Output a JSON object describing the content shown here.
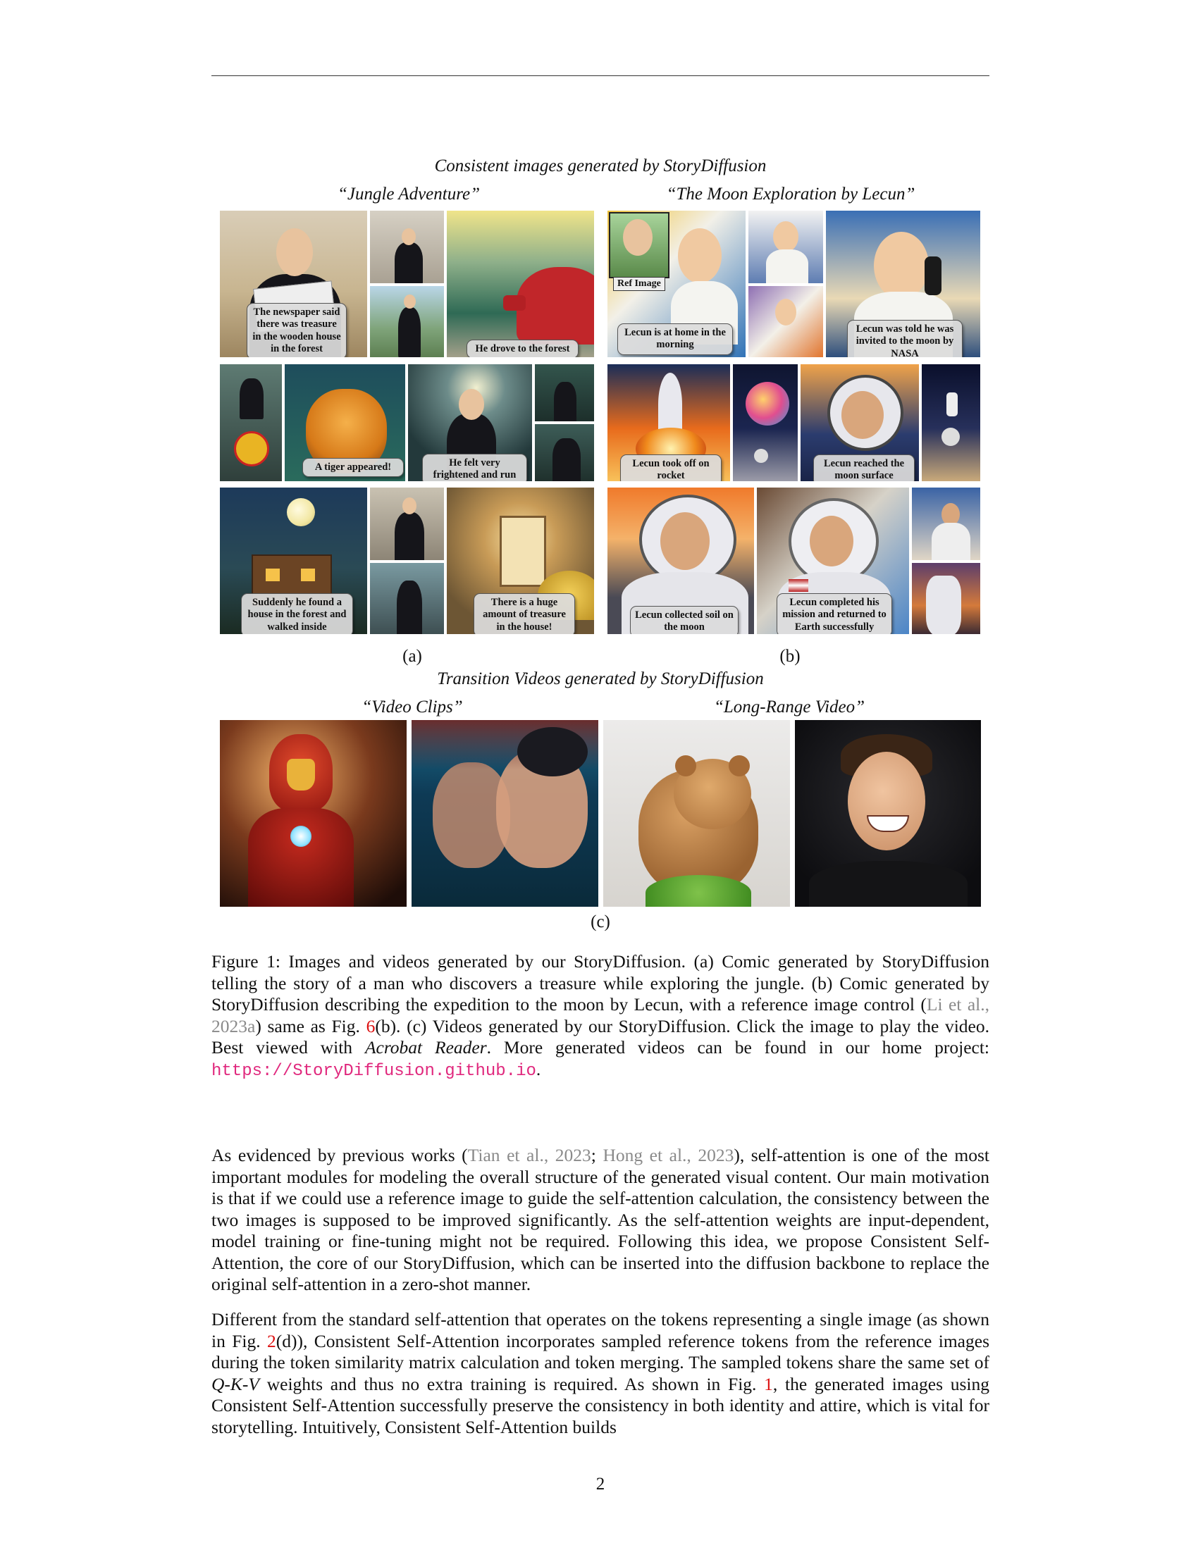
{
  "figure": {
    "top_title": "Consistent images generated by StoryDiffusion",
    "sub_a": "“Jungle Adventure”",
    "sub_b": "“The Moon Exploration by Lecun”",
    "label_a": "(a)",
    "label_b": "(b)",
    "bubbles_a": [
      "The newspaper said there was treasure in the wooden house in the forest",
      "He drove to the forest",
      "A tiger appeared!",
      "He felt very frightened and run",
      "Suddenly he found a house in the forest and walked inside",
      "There is a huge amount of treasure in the house!"
    ],
    "ref_tag": "Ref Image",
    "bubbles_b": [
      "Lecun is at home in the morning",
      "Lecun was told he was invited to the moon by NASA",
      "Lecun took off on rocket",
      "Lecun reached the moon surface",
      "Lecun collected soil on the moon",
      "Lecun completed his mission and returned to Earth successfully"
    ],
    "video_title": "Transition Videos generated by StoryDiffusion",
    "sub_c1": "“Video Clips”",
    "sub_c2": "“Long-Range Video”",
    "label_c": "(c)"
  },
  "caption": {
    "p1": "Figure 1: Images and videos generated by our StoryDiffusion. (a) Comic generated by StoryDiffusion telling the story of a man who discovers a treasure while exploring the jungle. (b) Comic generated by StoryDiffusion describing the expedition to the moon by Lecun, with a reference image control (",
    "cite1": "Li et al., 2023a",
    "p2": ") same as Fig. ",
    "ref6": "6",
    "p3": "(b). (c) Videos generated by our StoryDiffusion. Click the image to play the video. Best viewed with ",
    "acrobat": "Acrobat Reader",
    "p4": ". More generated videos can be found in our home project: ",
    "url": "https://StoryDiffusion.github.io",
    "p5": "."
  },
  "para1": {
    "a": "As evidenced by previous works (",
    "cite_tian": "Tian et al., 2023",
    "b": "; ",
    "cite_hong": "Hong et al., 2023",
    "c": "), self-attention is one of the most important modules for modeling the overall structure of the generated visual content. Our main motivation is that if we could use a reference image to guide the self-attention calculation, the consistency between the two images is supposed to be improved significantly. As the self-attention weights are input-dependent, model training or fine-tuning might not be required. Following this idea, we propose Consistent Self-Attention, the core of our StoryDiffusion, which can be inserted into the diffusion backbone to replace the original self-attention in a zero-shot manner."
  },
  "para2": {
    "a": "Different from the standard self-attention that operates on the tokens representing a single image (as shown in Fig. ",
    "ref2": "2",
    "b": "(d)), Consistent Self-Attention incorporates sampled reference tokens from the reference images during the token similarity matrix calculation and token merging. The sampled tokens share the same set of ",
    "qkv": "Q-K-V",
    "c": " weights and thus no extra training is required. As shown in Fig. ",
    "ref1": "1",
    "d": ", the generated images using Consistent Self-Attention successfully preserve the consistency in both identity and attire, which is vital for storytelling. Intuitively, Consistent Self-Attention builds"
  },
  "page_number": "2"
}
